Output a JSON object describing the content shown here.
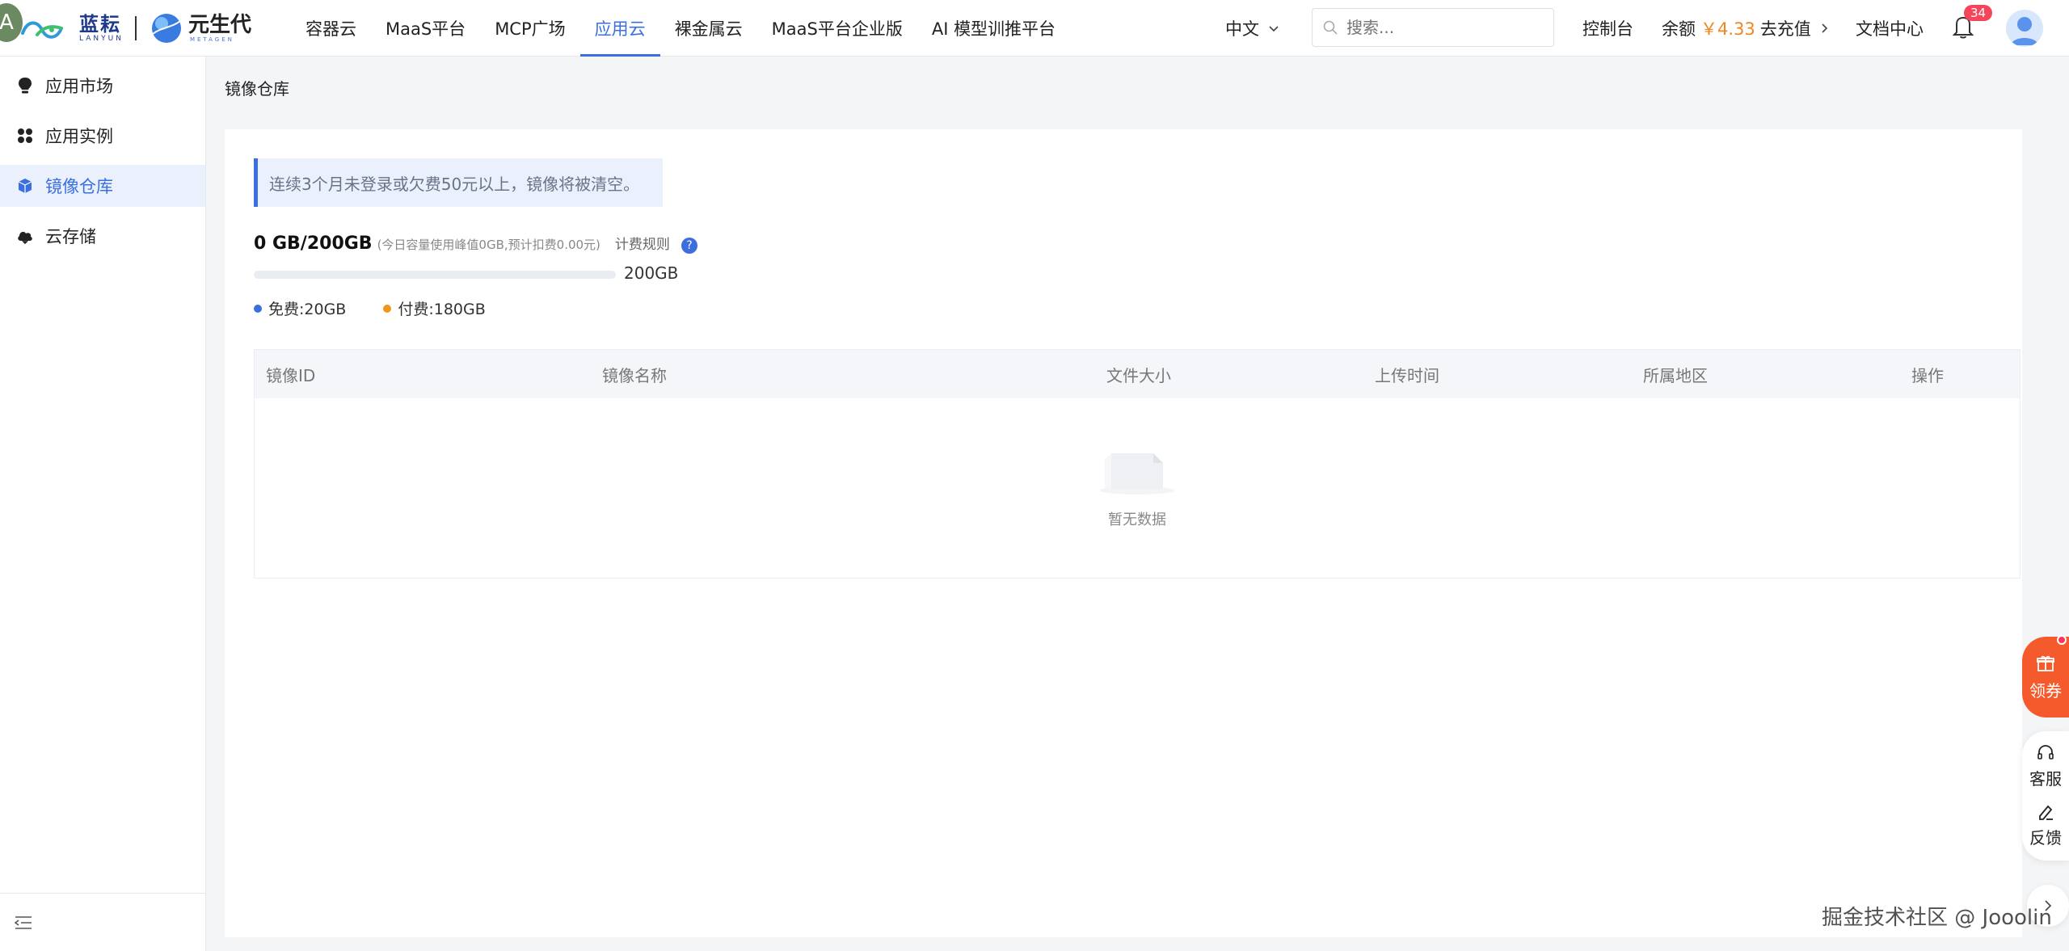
{
  "header": {
    "avatar_letter": "A",
    "logo_lanyun_cn": "蓝耘",
    "logo_lanyun_en": "LANYUN",
    "logo_ysd_cn": "元生代",
    "logo_ysd_en": "METAGEN",
    "nav": [
      {
        "label": "容器云",
        "active": false
      },
      {
        "label": "MaaS平台",
        "active": false
      },
      {
        "label": "MCP广场",
        "active": false
      },
      {
        "label": "应用云",
        "active": true
      },
      {
        "label": "裸金属云",
        "active": false
      },
      {
        "label": "MaaS平台企业版",
        "active": false
      },
      {
        "label": "AI 模型训推平台",
        "active": false
      }
    ],
    "language": "中文",
    "search_placeholder": "搜索...",
    "console": "控制台",
    "balance_label": "余额",
    "balance_amount": "￥4.33",
    "recharge": "去充值",
    "docs": "文档中心",
    "notification_count": "34",
    "accent_color": "#3b6fe0"
  },
  "sidebar": {
    "items": [
      {
        "label": "应用市场",
        "icon": "bulb-icon",
        "active": false
      },
      {
        "label": "应用实例",
        "icon": "grid-icon",
        "active": false
      },
      {
        "label": "镜像仓库",
        "icon": "cube-icon",
        "active": true
      },
      {
        "label": "云存储",
        "icon": "cloud-icon",
        "active": false
      }
    ]
  },
  "main": {
    "breadcrumb": "镜像仓库",
    "notice": "连续3个月未登录或欠费50元以上，镜像将被清空。",
    "usage_main": "0 GB/200GB",
    "usage_detail": "(今日容量使用峰值0GB,预计扣费0.00元)",
    "billing_rule": "计费规则",
    "usage_fraction": 0,
    "bar_max": "200GB",
    "legend": [
      {
        "label": "免费:20GB",
        "color": "#3b6fe0"
      },
      {
        "label": "付费:180GB",
        "color": "#f0961e"
      }
    ],
    "table": {
      "columns": [
        "镜像ID",
        "镜像名称",
        "文件大小",
        "上传时间",
        "所属地区",
        "操作"
      ],
      "rows": [],
      "empty_text": "暂无数据"
    }
  },
  "float": {
    "coupon": "领券",
    "service": "客服",
    "feedback": "反馈"
  },
  "watermark": "掘金技术社区 @ Jooolin"
}
